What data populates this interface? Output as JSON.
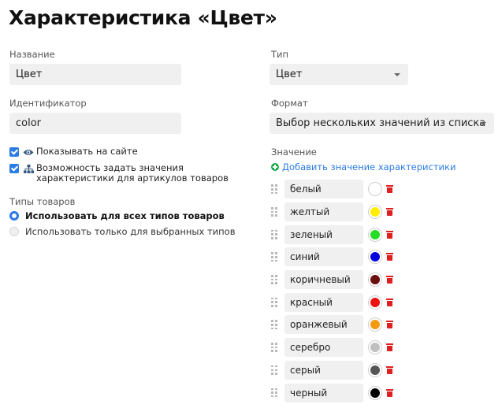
{
  "page_title": "Характеристика «Цвет»",
  "fields": {
    "name_label": "Название",
    "name_value": "Цвет",
    "id_label": "Идентификатор",
    "id_value": "color",
    "type_label": "Тип",
    "type_value": "Цвет",
    "format_label": "Формат",
    "format_value": "Выбор нескольких значений из списка"
  },
  "checkboxes": [
    {
      "label": "Показывать на сайте",
      "checked": true,
      "icon": "eye-icon"
    },
    {
      "label": "Возможность задать значения характеристики для артикулов товаров",
      "checked": true,
      "icon": "hierarchy-icon"
    }
  ],
  "product_types": {
    "label": "Типы товаров",
    "options": [
      {
        "label": "Использовать для всех типов товаров",
        "selected": true
      },
      {
        "label": "Использовать только для выбранных типов",
        "selected": false
      }
    ]
  },
  "values_section": {
    "label": "Значение",
    "add_link": "Добавить значение характеристики",
    "items": [
      {
        "name": "белый",
        "color": "#ffffff"
      },
      {
        "name": "желтый",
        "color": "#ffee00"
      },
      {
        "name": "зеленый",
        "color": "#22dd22"
      },
      {
        "name": "синий",
        "color": "#0000dd"
      },
      {
        "name": "коричневый",
        "color": "#6b0f0f"
      },
      {
        "name": "красный",
        "color": "#ee1111"
      },
      {
        "name": "оранжевый",
        "color": "#f59a10"
      },
      {
        "name": "серебро",
        "color": "#c0c0c0"
      },
      {
        "name": "серый",
        "color": "#555555"
      },
      {
        "name": "черный",
        "color": "#000000"
      }
    ]
  },
  "colors": {
    "accent": "#2b7be4",
    "add": "#1aa84a",
    "delete": "#e02020"
  }
}
